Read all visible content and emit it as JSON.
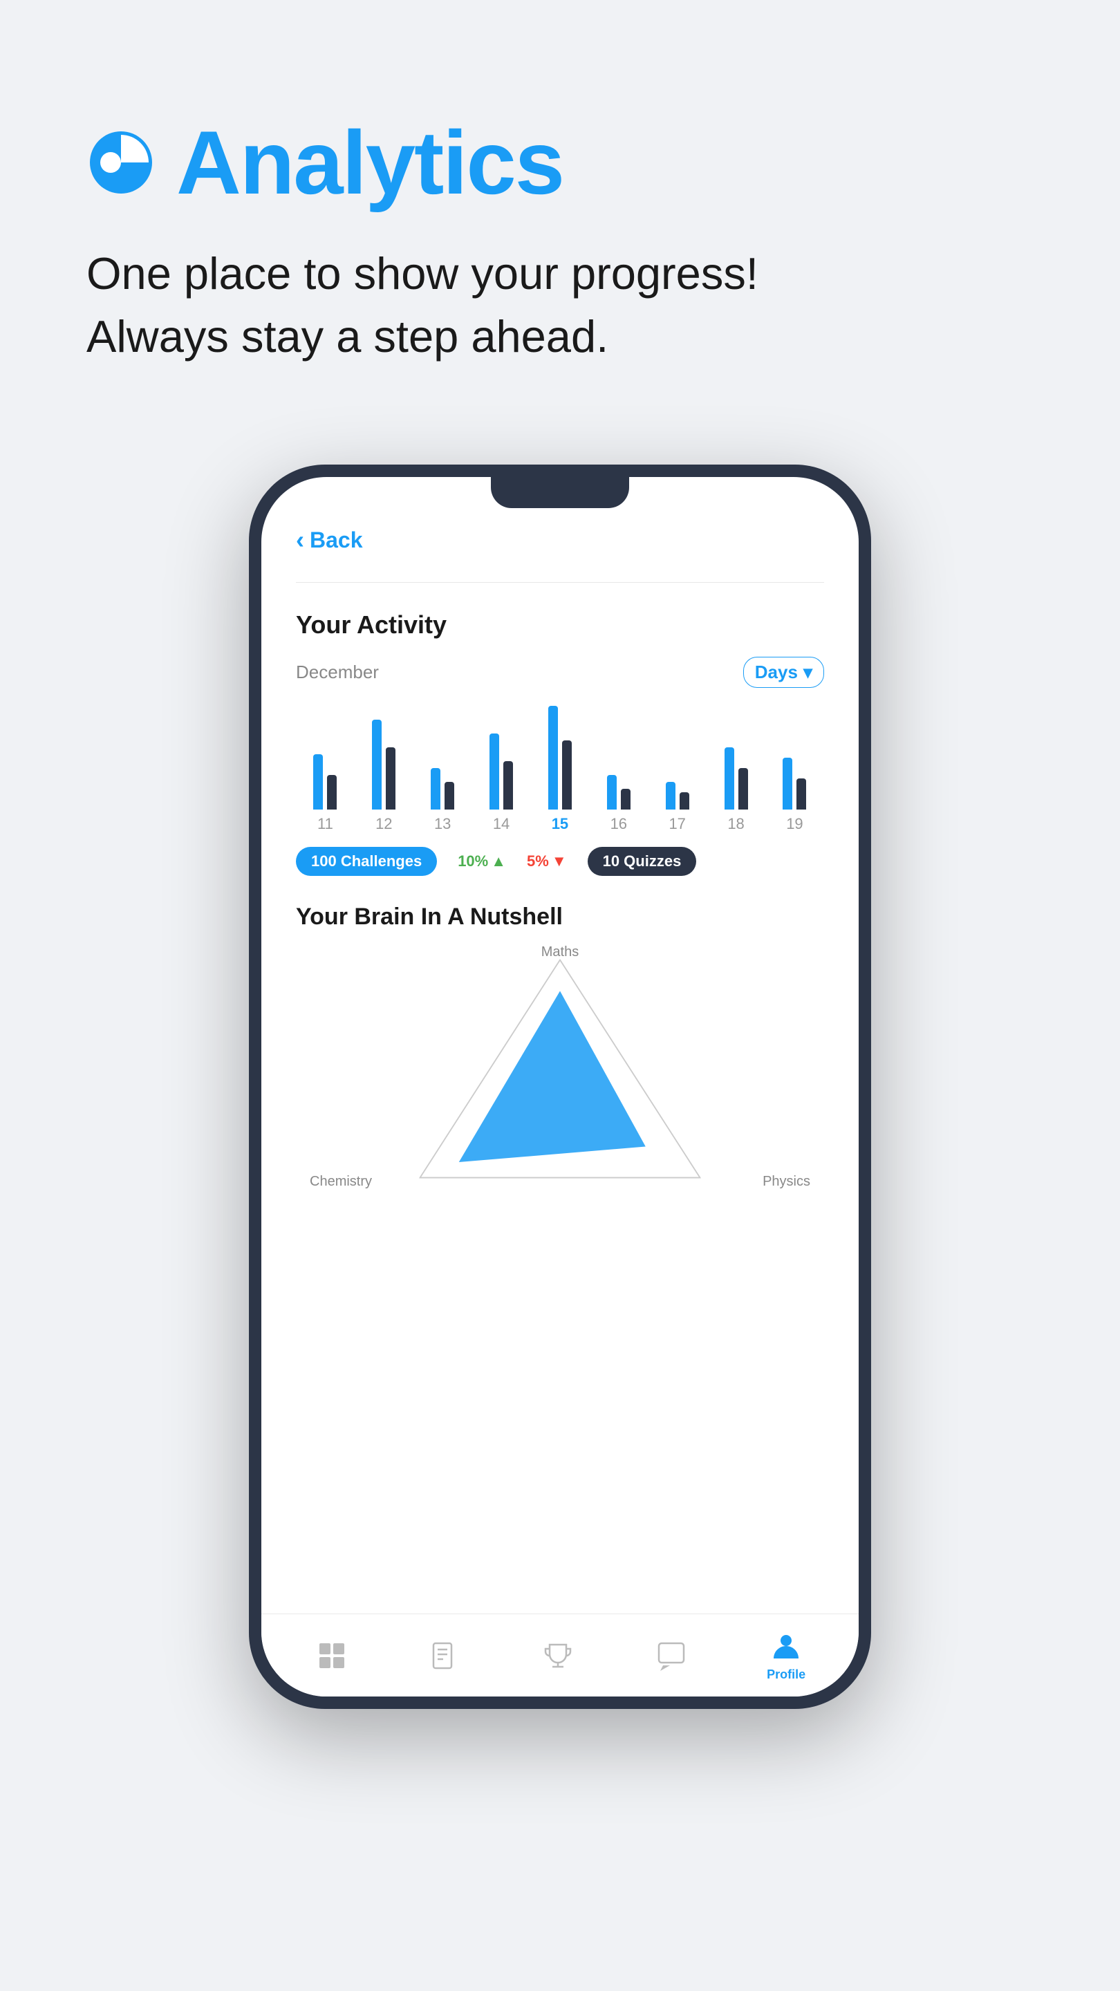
{
  "header": {
    "title": "Analytics",
    "subtitle_line1": "One place to show your progress!",
    "subtitle_line2": "Always stay a step ahead."
  },
  "phone": {
    "back_label": "Back",
    "activity": {
      "title": "Your Activity",
      "month": "December",
      "filter": "Days",
      "bars": [
        {
          "day": "11",
          "heights": [
            80,
            50
          ],
          "active": false
        },
        {
          "day": "12",
          "heights": [
            130,
            90
          ],
          "active": false
        },
        {
          "day": "13",
          "heights": [
            60,
            40
          ],
          "active": false
        },
        {
          "day": "14",
          "heights": [
            110,
            70
          ],
          "active": false
        },
        {
          "day": "15",
          "heights": [
            150,
            100
          ],
          "active": true
        },
        {
          "day": "16",
          "heights": [
            50,
            30
          ],
          "active": false
        },
        {
          "day": "17",
          "heights": [
            40,
            25
          ],
          "active": false
        },
        {
          "day": "18",
          "heights": [
            90,
            60
          ],
          "active": false
        },
        {
          "day": "19",
          "heights": [
            75,
            45
          ],
          "active": false
        }
      ],
      "stats": {
        "challenges": "100 Challenges",
        "change_up": "10%",
        "change_down": "5%",
        "quizzes": "10 Quizzes"
      }
    },
    "brain": {
      "title": "Your Brain In A Nutshell",
      "subjects": {
        "top": "Maths",
        "left": "Chemistry",
        "right": "Physics"
      }
    },
    "nav": {
      "items": [
        {
          "label": "",
          "icon": "grid-icon",
          "active": false
        },
        {
          "label": "",
          "icon": "book-icon",
          "active": false
        },
        {
          "label": "",
          "icon": "trophy-icon",
          "active": false
        },
        {
          "label": "",
          "icon": "chat-icon",
          "active": false
        },
        {
          "label": "Profile",
          "icon": "profile-icon",
          "active": true
        }
      ]
    }
  }
}
